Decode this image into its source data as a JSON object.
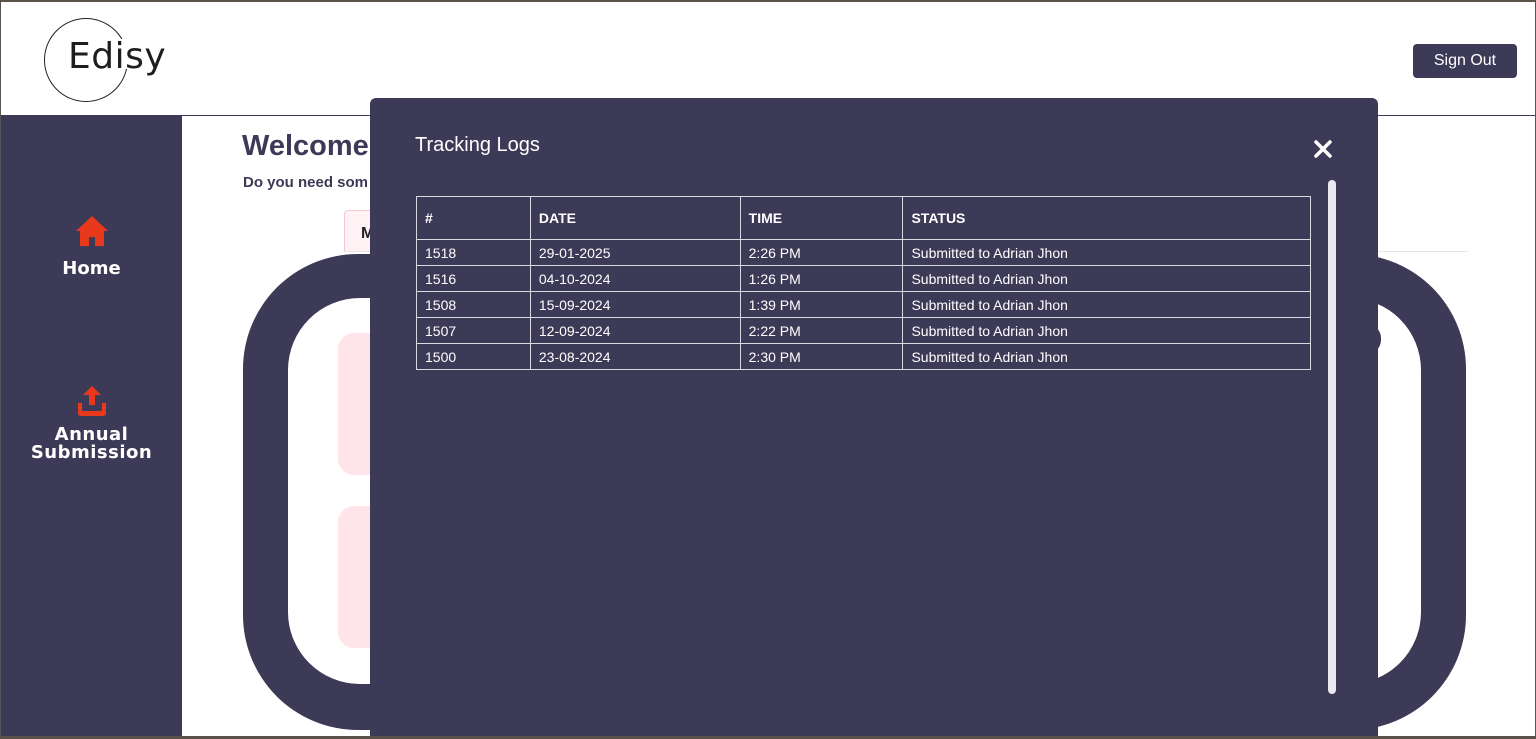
{
  "header": {
    "logo_text": "Edisy",
    "sign_out_label": "Sign Out"
  },
  "sidebar": {
    "items": [
      {
        "label": "Home",
        "icon": "home-icon",
        "icon_color": "#e8391c"
      },
      {
        "label": "Annual Submission",
        "label_line1": "Annual",
        "label_line2": "Submission",
        "icon": "upload-icon",
        "icon_color": "#e8391c"
      }
    ]
  },
  "main": {
    "title": "Welcome",
    "subtitle": "Do you need som",
    "tab_label": "M"
  },
  "modal": {
    "title": "Tracking Logs",
    "close_icon": "close-icon",
    "columns": [
      "#",
      "DATE",
      "TIME",
      "STATUS"
    ],
    "rows": [
      {
        "id": "1518",
        "date": "29-01-2025",
        "time": "2:26 PM",
        "status": "Submitted to Adrian Jhon"
      },
      {
        "id": "1516",
        "date": "04-10-2024",
        "time": "1:26 PM",
        "status": "Submitted to Adrian Jhon"
      },
      {
        "id": "1508",
        "date": "15-09-2024",
        "time": "1:39 PM",
        "status": "Submitted to Adrian Jhon"
      },
      {
        "id": "1507",
        "date": "12-09-2024",
        "time": "2:22 PM",
        "status": "Submitted to Adrian Jhon"
      },
      {
        "id": "1500",
        "date": "23-08-2024",
        "time": "2:30 PM",
        "status": "Submitted to Adrian Jhon"
      }
    ]
  },
  "colors": {
    "primary": "#3c3a56",
    "accent": "#e8391c",
    "pink": "#ffe4ea"
  }
}
